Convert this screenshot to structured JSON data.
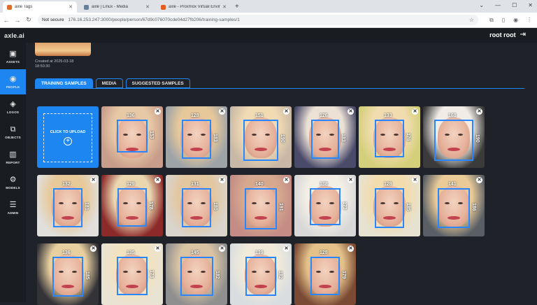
{
  "browser": {
    "tabs": [
      {
        "label": "axle Tags",
        "fav": "#e06c2b",
        "active": true
      },
      {
        "label": "axle | Linux - Media",
        "fav": "#6a7f99",
        "active": false
      },
      {
        "label": "axle - Proxmox Virtual Environ...",
        "fav": "#e55a1f",
        "active": false
      }
    ],
    "new_tab": "+",
    "security": "Not secure",
    "url": "176.16.253.247:3000/people/person/67d9c076070cde04d27fb206/training-samples/1"
  },
  "app": {
    "logo": "axle.ai",
    "user_name": "root root",
    "created_label": "Created at 2025-03-18",
    "created_time": "18:50:30",
    "tabs": [
      {
        "label": "TRAINING SAMPLES",
        "active": true
      },
      {
        "label": "MEDIA",
        "active": false
      },
      {
        "label": "SUGGESTED SAMPLES",
        "active": false
      }
    ],
    "upload_label": "CLICK TO UPLOAD",
    "upload_plus": "+"
  },
  "sidebar": {
    "items": [
      {
        "label": "ASSETS",
        "icon": "image-icon",
        "glyph": "▣",
        "active": false
      },
      {
        "label": "PEOPLE",
        "icon": "person-icon",
        "glyph": "◉",
        "active": true
      },
      {
        "label": "LOGOS",
        "icon": "tag-icon",
        "glyph": "◈",
        "active": false
      },
      {
        "label": "OBJECTS",
        "icon": "objects-icon",
        "glyph": "⧉",
        "active": false
      },
      {
        "label": "REPORT",
        "icon": "report-icon",
        "glyph": "▥",
        "active": false
      },
      {
        "label": "MODELS",
        "icon": "models-icon",
        "glyph": "⚙",
        "active": false
      },
      {
        "label": "ADMIN",
        "icon": "admin-icon",
        "glyph": "☰",
        "active": false
      }
    ]
  },
  "samples": [
    {
      "w": "136",
      "h": "153",
      "bg": "#c99d8b",
      "hair": "#e8c9a6"
    },
    {
      "w": "128",
      "h": "183",
      "bg": "#9ea3a8",
      "hair": "#e6c89a"
    },
    {
      "w": "151",
      "h": "190",
      "bg": "#c9b8a6",
      "hair": "#f0dbb3"
    },
    {
      "w": "126",
      "h": "183",
      "bg": "#4a4a6a",
      "hair": "#ebe1d5"
    },
    {
      "w": "133",
      "h": "176",
      "bg": "#d4cf7a",
      "hair": "#f0dcae"
    },
    {
      "w": "168",
      "h": "190",
      "bg": "#3b3b3b",
      "hair": "#f1ede6"
    },
    {
      "w": "132",
      "h": "181",
      "bg": "#e0dfdc",
      "hair": "#e8c99a"
    },
    {
      "w": "129",
      "h": "178",
      "bg": "#8c2a2a",
      "hair": "#ead7b0"
    },
    {
      "w": "131",
      "h": "180",
      "bg": "#d9d4cc",
      "hair": "#e3c7a0"
    },
    {
      "w": "140",
      "h": "191",
      "bg": "#c48c85",
      "hair": "#d6a98f"
    },
    {
      "w": "138",
      "h": "173",
      "bg": "#d8d8d8",
      "hair": "#f3efe6"
    },
    {
      "w": "128",
      "h": "185",
      "bg": "#e6e2d2",
      "hair": "#f2dcae"
    },
    {
      "w": "141",
      "h": "186",
      "bg": "#5a5f66",
      "hair": "#eacb98"
    },
    {
      "w": "136",
      "h": "185",
      "bg": "#333338",
      "hair": "#e8cf9f"
    },
    {
      "w": "135",
      "h": "178",
      "bg": "#e9e3d4",
      "hair": "#f1e2c0"
    },
    {
      "w": "145",
      "h": "182",
      "bg": "#8f8f8f",
      "hair": "#d9c3a3"
    },
    {
      "w": "139",
      "h": "182",
      "bg": "#d9dde0",
      "hair": "#f1ead9"
    },
    {
      "w": "128",
      "h": "179",
      "bg": "#7a4a34",
      "hair": "#e3c189"
    }
  ]
}
